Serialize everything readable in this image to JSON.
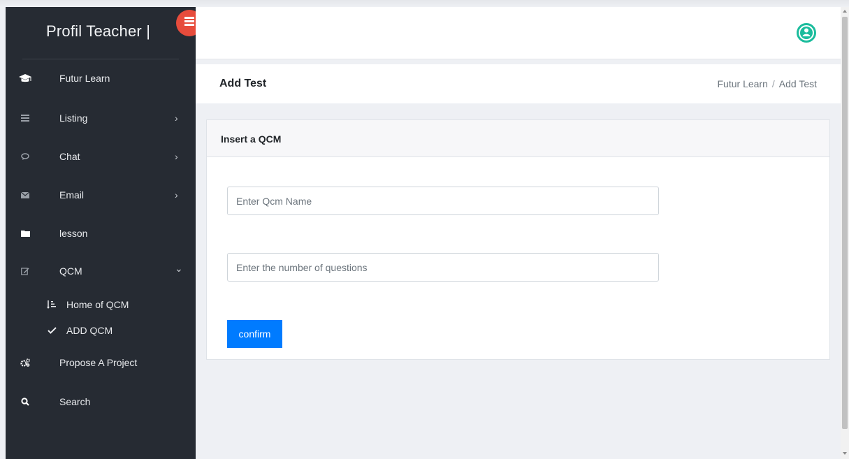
{
  "sidebar": {
    "title": "Profil Teacher |",
    "items": [
      {
        "label": "Futur Learn",
        "icon": "graduation-cap-icon"
      },
      {
        "label": "Listing",
        "icon": "list-icon",
        "arrow": "›"
      },
      {
        "label": "Chat",
        "icon": "chat-icon",
        "arrow": "›"
      },
      {
        "label": "Email",
        "icon": "envelope-icon",
        "arrow": "›"
      },
      {
        "label": "lesson",
        "icon": "folder-icon"
      },
      {
        "label": "QCM",
        "icon": "edit-icon",
        "arrow": "⌄"
      },
      {
        "label": "Propose A Project",
        "icon": "cogs-icon"
      },
      {
        "label": "Search",
        "icon": "search-icon"
      }
    ],
    "sub_items": [
      {
        "label": "Home of QCM",
        "icon": "sort-icon"
      },
      {
        "label": "ADD QCM",
        "icon": "check-icon"
      }
    ]
  },
  "page": {
    "title": "Add Test",
    "breadcrumb": {
      "home": "Futur Learn",
      "separator": "/",
      "current": "Add Test"
    }
  },
  "card": {
    "title": "Insert a QCM",
    "name_placeholder": "Enter Qcm Name",
    "questions_placeholder": "Enter the number of questions",
    "confirm_label": "confirm"
  },
  "colors": {
    "sidebar_bg": "#262b33",
    "toggle_red": "#e74c3c",
    "avatar_green": "#1abc9c",
    "primary_blue": "#007bff"
  }
}
